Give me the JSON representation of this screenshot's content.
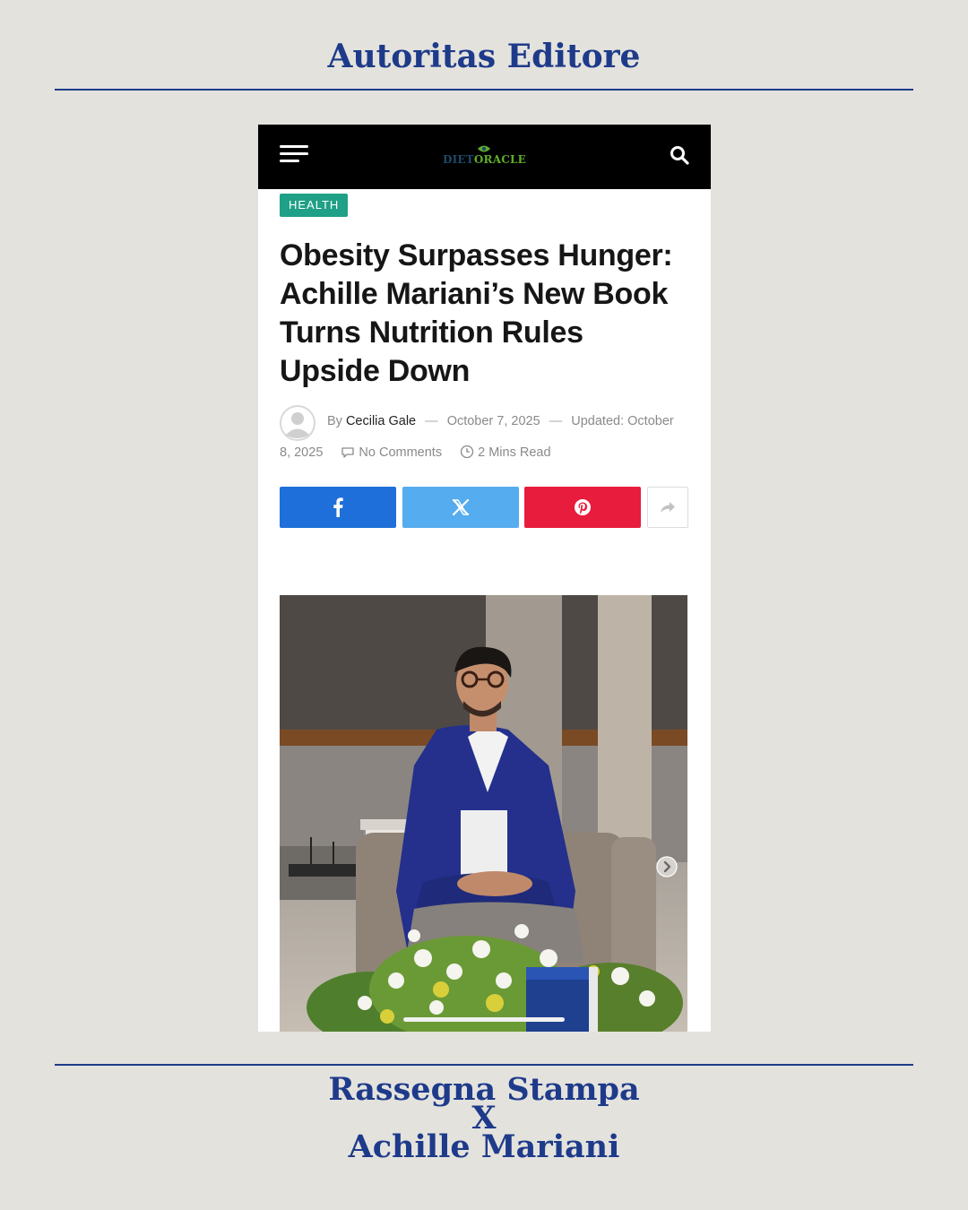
{
  "page": {
    "brand_title": "Autoritas Editore",
    "footer_lines": [
      "Rassegna Stampa",
      "X",
      "Achille Mariani"
    ]
  },
  "site": {
    "logo": {
      "part1": "DIET",
      "part2": "ORACLE"
    },
    "icons": {
      "menu": "hamburger-menu-icon",
      "search": "search-icon"
    }
  },
  "article": {
    "category": "HEALTH",
    "headline_lines": [
      "Obesity Surpasses Hunger:",
      "Achille Mariani’s New Book",
      "Turns Nutrition Rules",
      "Upside Down"
    ],
    "byline": {
      "by": "By",
      "author": "Cecilia Gale",
      "published": "October 7, 2025",
      "updated_label": "Updated:",
      "updated_part1": "October",
      "updated_part2": "8, 2025",
      "comments": "No Comments",
      "read_time": "2 Mins Read"
    },
    "share_buttons": [
      {
        "network": "facebook",
        "icon": "facebook-icon",
        "color": "#1e6fd9"
      },
      {
        "network": "x",
        "icon": "x-icon",
        "color": "#55acee"
      },
      {
        "network": "pinterest",
        "icon": "pinterest-icon",
        "color": "#e81c3c"
      },
      {
        "network": "more",
        "icon": "share-arrow-icon",
        "color": "#ffffff"
      }
    ],
    "image": {
      "subject": "man-in-blue-blazer-seated-in-armchair-with-flowers-and-book"
    }
  },
  "colors": {
    "brand_blue": "#1e3a8a",
    "background": "#e3e2dd",
    "category_green": "#20a086"
  }
}
